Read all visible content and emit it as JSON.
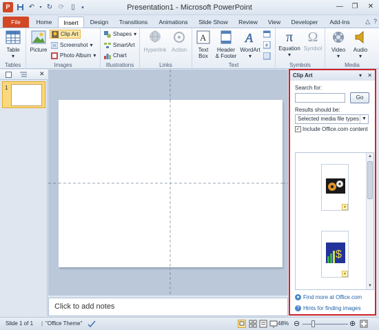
{
  "window": {
    "title": "Presentation1 - Microsoft PowerPoint",
    "app_icon": "P"
  },
  "tabs": [
    {
      "label": "File"
    },
    {
      "label": "Home"
    },
    {
      "label": "Insert"
    },
    {
      "label": "Design"
    },
    {
      "label": "Transitions"
    },
    {
      "label": "Animations"
    },
    {
      "label": "Slide Show"
    },
    {
      "label": "Review"
    },
    {
      "label": "View"
    },
    {
      "label": "Developer"
    },
    {
      "label": "Add-Ins"
    }
  ],
  "ribbon": {
    "tables": {
      "table": "Table",
      "group": "Tables"
    },
    "images": {
      "picture": "Picture",
      "clipart": "Clip Art",
      "screenshot": "Screenshot",
      "photoalbum": "Photo Album",
      "group": "Images"
    },
    "illustrations": {
      "shapes": "Shapes",
      "smartart": "SmartArt",
      "chart": "Chart",
      "group": "Illustrations"
    },
    "links": {
      "hyperlink": "Hyperlink",
      "action": "Action",
      "group": "Links"
    },
    "text": {
      "textbox_1": "Text",
      "textbox_2": "Box",
      "header_1": "Header",
      "header_2": "& Footer",
      "wordart": "WordArt",
      "group": "Text"
    },
    "symbols": {
      "equation": "Equation",
      "symbol": "Symbol",
      "group": "Symbols"
    },
    "media": {
      "video": "Video",
      "audio": "Audio",
      "group": "Media"
    }
  },
  "slides_pane": {
    "slide_number": "1"
  },
  "notes": {
    "placeholder": "Click to add notes"
  },
  "clipart_pane": {
    "title": "Clip Art",
    "search_label": "Search for:",
    "search_value": "",
    "go_label": "Go",
    "results_label": "Results should be:",
    "media_type": "Selected media file types",
    "include_office": "Include Office.com content",
    "include_office_checked": "✓",
    "find_more": "Find more at Office.com",
    "hints": "Hints for finding images"
  },
  "status": {
    "slide": "Slide 1 of 1",
    "theme": "\"Office Theme\"",
    "zoom": "48%"
  },
  "colors": {
    "file_tab": "#d24726",
    "selection": "#fde7a5",
    "highlight_border": "#d2232a"
  }
}
